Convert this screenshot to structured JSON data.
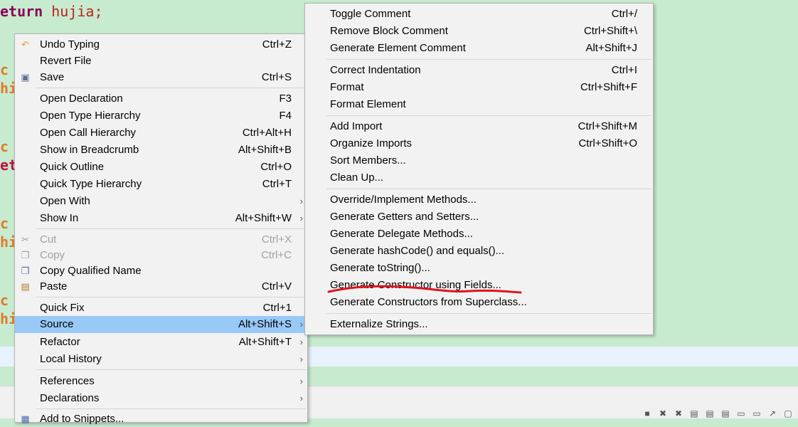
{
  "editor": {
    "line1_keyword": "eturn",
    "line1_var": "hujia",
    "line1_semi": ";",
    "fragments": [
      "c",
      "hi",
      "c",
      "et",
      "c",
      "hi",
      "c",
      "hi"
    ]
  },
  "main_menu": {
    "items": [
      {
        "label": "Undo Typing",
        "accel": "Ctrl+Z",
        "icon": "undo-icon"
      },
      {
        "label": "Revert File",
        "accel": ""
      },
      {
        "label": "Save",
        "accel": "Ctrl+S",
        "icon": "save-icon"
      },
      {
        "label": "Open Declaration",
        "accel": "F3"
      },
      {
        "label": "Open Type Hierarchy",
        "accel": "F4"
      },
      {
        "label": "Open Call Hierarchy",
        "accel": "Ctrl+Alt+H"
      },
      {
        "label": "Show in Breadcrumb",
        "accel": "Alt+Shift+B"
      },
      {
        "label": "Quick Outline",
        "accel": "Ctrl+O"
      },
      {
        "label": "Quick Type Hierarchy",
        "accel": "Ctrl+T"
      },
      {
        "label": "Open With",
        "accel": ""
      },
      {
        "label": "Show In",
        "accel": "Alt+Shift+W"
      },
      {
        "label": "Cut",
        "accel": "Ctrl+X",
        "icon": "cut-icon"
      },
      {
        "label": "Copy",
        "accel": "Ctrl+C",
        "icon": "copy-icon"
      },
      {
        "label": "Copy Qualified Name",
        "accel": "",
        "icon": "copy-qualified-icon"
      },
      {
        "label": "Paste",
        "accel": "Ctrl+V",
        "icon": "paste-icon"
      },
      {
        "label": "Quick Fix",
        "accel": "Ctrl+1"
      },
      {
        "label": "Source",
        "accel": "Alt+Shift+S"
      },
      {
        "label": "Refactor",
        "accel": "Alt+Shift+T"
      },
      {
        "label": "Local History",
        "accel": ""
      },
      {
        "label": "References",
        "accel": ""
      },
      {
        "label": "Declarations",
        "accel": ""
      },
      {
        "label": "Add to Snippets...",
        "accel": "",
        "icon": "snippets-icon"
      }
    ]
  },
  "sub_menu": {
    "items": [
      {
        "label": "Toggle Comment",
        "accel": "Ctrl+/"
      },
      {
        "label": "Remove Block Comment",
        "accel": "Ctrl+Shift+\\"
      },
      {
        "label": "Generate Element Comment",
        "accel": "Alt+Shift+J"
      },
      {
        "label": "Correct Indentation",
        "accel": "Ctrl+I"
      },
      {
        "label": "Format",
        "accel": "Ctrl+Shift+F"
      },
      {
        "label": "Format Element",
        "accel": ""
      },
      {
        "label": "Add Import",
        "accel": "Ctrl+Shift+M"
      },
      {
        "label": "Organize Imports",
        "accel": "Ctrl+Shift+O"
      },
      {
        "label": "Sort Members...",
        "accel": ""
      },
      {
        "label": "Clean Up...",
        "accel": ""
      },
      {
        "label": "Override/Implement Methods...",
        "accel": ""
      },
      {
        "label": "Generate Getters and Setters...",
        "accel": ""
      },
      {
        "label": "Generate Delegate Methods...",
        "accel": ""
      },
      {
        "label": "Generate hashCode() and equals()...",
        "accel": ""
      },
      {
        "label": "Generate toString()...",
        "accel": ""
      },
      {
        "label": "Generate Constructor using Fields...",
        "accel": ""
      },
      {
        "label": "Generate Constructors from Superclass...",
        "accel": ""
      },
      {
        "label": "Externalize Strings...",
        "accel": ""
      }
    ]
  },
  "colors": {
    "editor_bg": "#c7ebcf",
    "selection": "#99c9f7",
    "annotation_red": "#e0141e"
  }
}
